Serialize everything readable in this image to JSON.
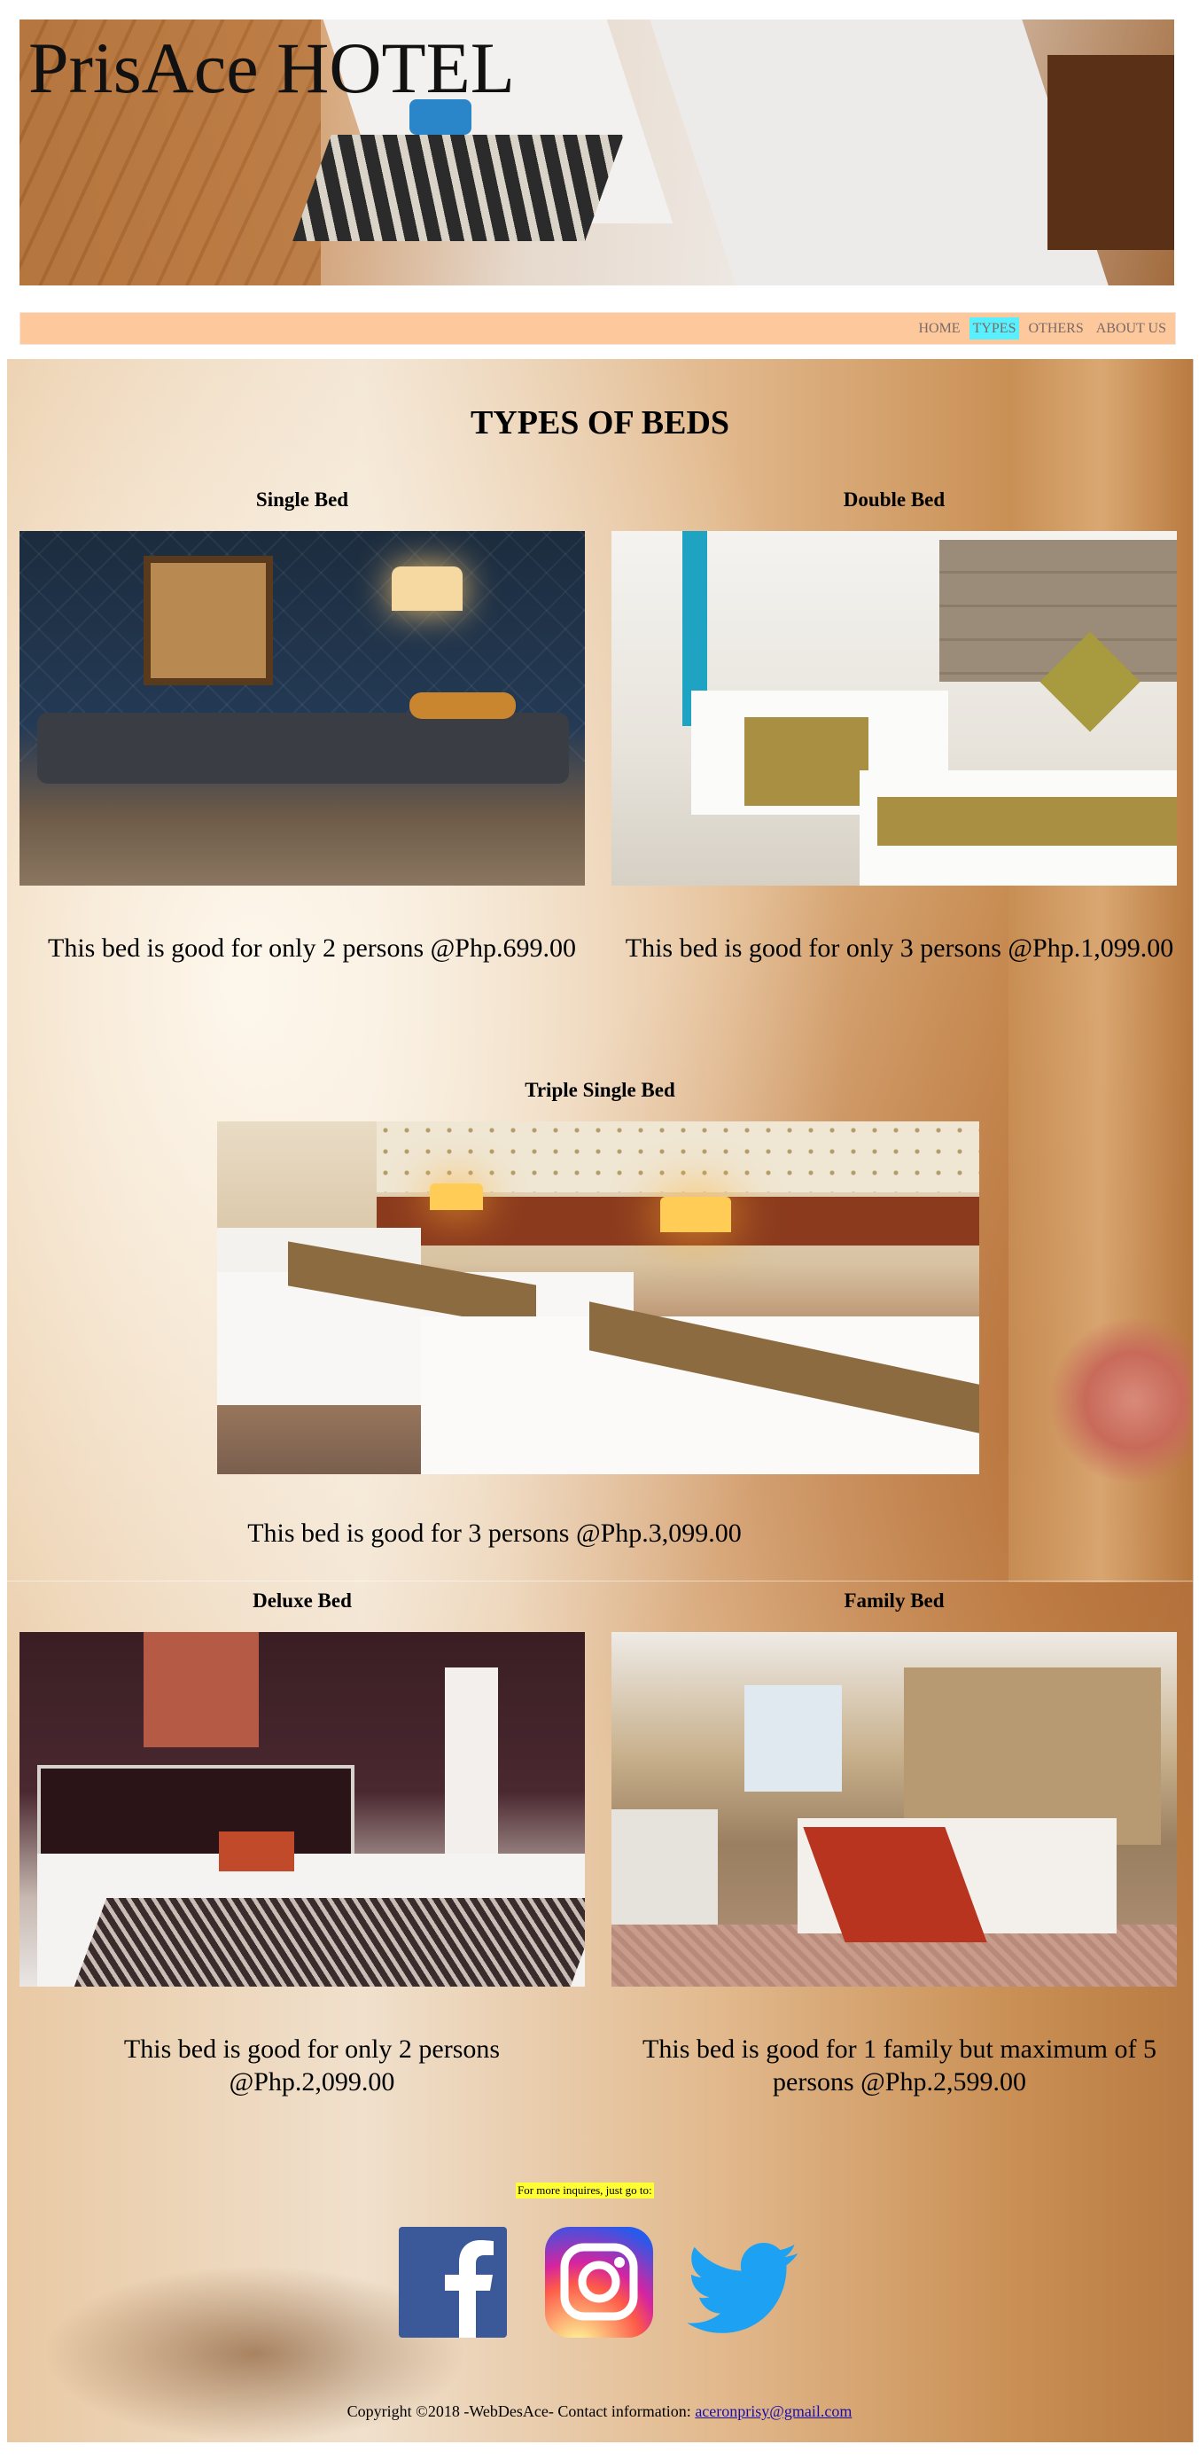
{
  "header": {
    "site_title": "PrisAce HOTEL"
  },
  "nav": {
    "items": [
      {
        "label": "HOME",
        "active": false
      },
      {
        "label": "TYPES",
        "active": true
      },
      {
        "label": "OTHERS",
        "active": false
      },
      {
        "label": "ABOUT US",
        "active": false
      }
    ],
    "bar_color": "#fdc99c",
    "active_color": "#58f0ff"
  },
  "main": {
    "heading": "TYPES OF BEDS",
    "beds": [
      {
        "title": "Single Bed",
        "description": "This bed is good for only 2 persons @Php.699.00"
      },
      {
        "title": "Double Bed",
        "description": "This bed is good for only 3 persons @Php.1,099.00"
      },
      {
        "title": "Triple Single Bed",
        "description": "This bed is good for 3 persons @Php.3,099.00"
      },
      {
        "title": "Deluxe Bed",
        "description": "This bed is good for only 2 persons @Php.2,099.00"
      },
      {
        "title": "Family Bed",
        "description": "This bed is good for 1 family but maximum of 5 persons @Php.2,599.00"
      }
    ]
  },
  "footer": {
    "inquiry_note": "For more inquires, just go to:",
    "social_icons": [
      "facebook-icon",
      "instagram-icon",
      "twitter-icon"
    ],
    "copyright_text": "Copyright ©2018 -WebDesAce- Contact information: ",
    "email": "aceronprisy@gmail.com",
    "inquiry_highlight": "#ffff33"
  }
}
